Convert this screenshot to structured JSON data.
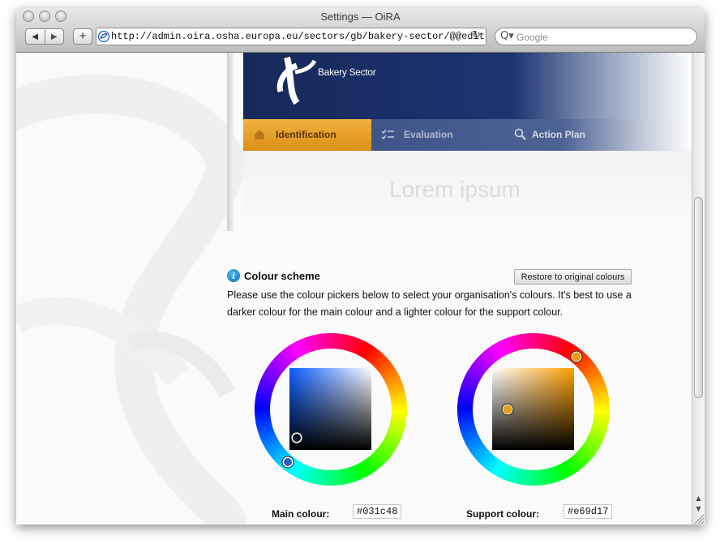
{
  "window": {
    "title": "Settings — OiRA"
  },
  "toolbar": {
    "back_icon": "◀",
    "forward_icon": "▶",
    "add_icon": "+",
    "url": "http://admin.oira.osha.europa.eu/sectors/gb/bakery-sector/@@edit",
    "reload_icon": "↻",
    "search_placeholder": "Google",
    "search_icon": "Q▾"
  },
  "preview": {
    "sector_name": "Bakery Sector",
    "tabs": [
      {
        "label": "Identification",
        "active": true
      },
      {
        "label": "Evaluation",
        "active": false
      },
      {
        "label": "Action Plan",
        "active": false
      }
    ],
    "heading": "Lorem ipsum"
  },
  "colour_scheme": {
    "info_glyph": "i",
    "title": "Colour scheme",
    "restore_button": "Restore to original colours",
    "description": "Please use the colour pickers below to select your organisation's colours. It's best to use a darker colour for the main colour and a lighter colour for the support colour.",
    "main": {
      "label": "Main colour:",
      "value": "#031c48"
    },
    "support": {
      "label": "Support colour:",
      "value": "#e69d17"
    }
  },
  "colors": {
    "main": "#031c48",
    "support": "#e69d17",
    "banner": "#1c3370",
    "tab_active": "#e69d17"
  },
  "scrollbar": {
    "up_icon": "▲",
    "down_icon": "▼"
  }
}
